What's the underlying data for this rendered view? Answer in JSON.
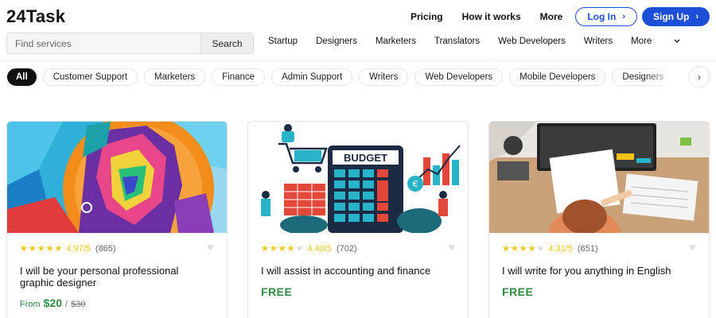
{
  "brand": {
    "name": "24Task"
  },
  "topnav": {
    "links": [
      "Pricing",
      "How it works",
      "More"
    ],
    "login": "Log In",
    "signup": "Sign Up"
  },
  "search": {
    "placeholder": "Find services",
    "button": "Search"
  },
  "categories": {
    "items": [
      "Startup",
      "Designers",
      "Marketers",
      "Translators",
      "Web Developers",
      "Writers"
    ],
    "more": "More"
  },
  "chips": [
    "All",
    "Customer Support",
    "Marketers",
    "Finance",
    "Admin Support",
    "Writers",
    "Web Developers",
    "Mobile Developers",
    "Designers"
  ],
  "icons": {
    "chevron_right": "chevron-right-icon",
    "chevron_down": "chevron-down-icon",
    "heart": "heart-icon",
    "star": "star-icon"
  },
  "colors": {
    "accent": "#1d4ed8",
    "price_green": "#2e8b3f",
    "star": "#f5c518"
  },
  "cards": [
    {
      "image": "colorful-portrait-artwork",
      "stars": 5,
      "score": "4.97/5",
      "count": "(865)",
      "title": "I will be your personal professional graphic designer",
      "price_prefix": "From",
      "price": "$20",
      "price_sep": "/",
      "price_old": "$30"
    },
    {
      "image": "budget-calculator-illustration",
      "image_text": "BUDGET",
      "stars": 4,
      "score": "4.40/5",
      "count": "(702)",
      "title": "I will assist in accounting and finance",
      "price": "FREE"
    },
    {
      "image": "person-writing-at-desk-photo",
      "stars": 4,
      "score": "4.31/5",
      "count": "(651)",
      "title": "I will write for you anything in English",
      "price": "FREE"
    }
  ]
}
